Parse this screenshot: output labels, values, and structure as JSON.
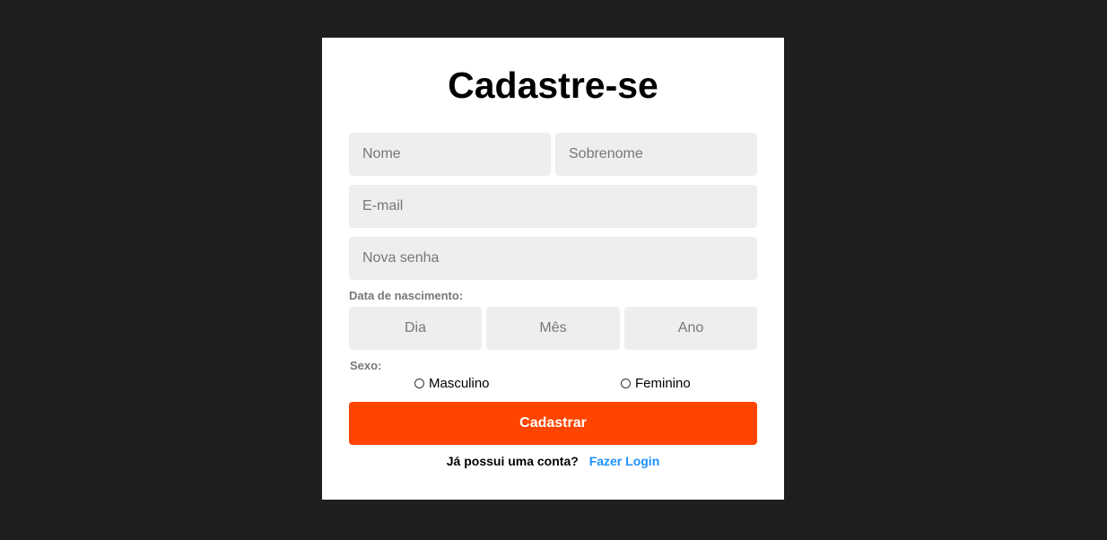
{
  "form": {
    "title": "Cadastre-se",
    "first_name_placeholder": "Nome",
    "last_name_placeholder": "Sobrenome",
    "email_placeholder": "E-mail",
    "password_placeholder": "Nova senha",
    "birthdate_label": "Data de nascimento:",
    "day_placeholder": "Dia",
    "month_placeholder": "Mês",
    "year_placeholder": "Ano",
    "sex_label": "Sexo:",
    "sex_options": [
      "Masculino",
      "Feminino"
    ],
    "submit_label": "Cadastrar",
    "login_question": "Já possui uma conta?",
    "login_link": "Fazer Login"
  },
  "colors": {
    "page_background": "#1e1e1e",
    "card_background": "#ffffff",
    "input_background": "#eeeeee",
    "accent": "#ff4500",
    "link": "#1e90ff"
  }
}
